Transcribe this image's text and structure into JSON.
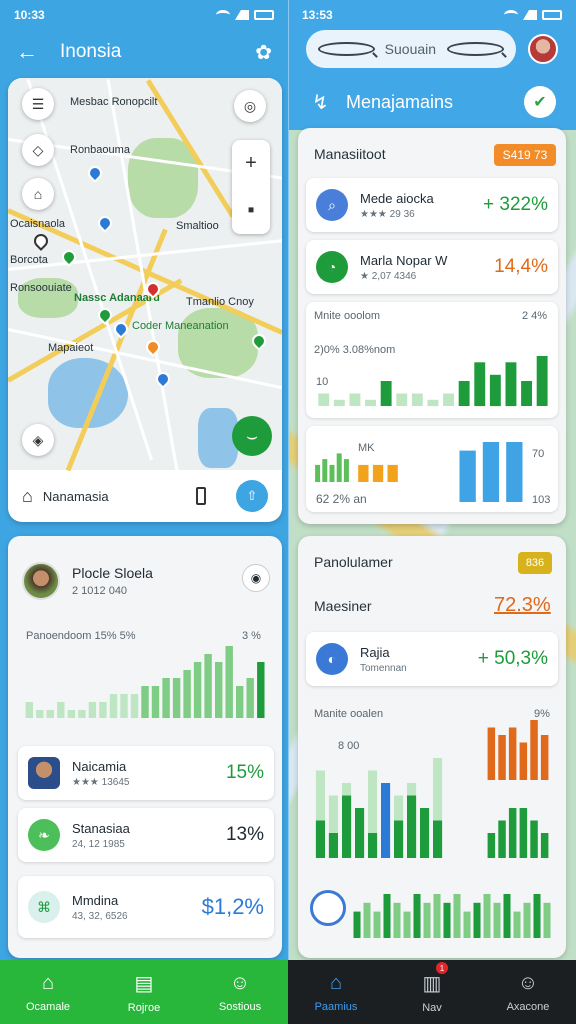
{
  "status": {
    "left_time": "10:33",
    "right_time": "13:53"
  },
  "left_header": {
    "title": "Inonsia"
  },
  "right_header": {
    "search_placeholder": "Suouain",
    "title": "Menajamains"
  },
  "map": {
    "labels": [
      "Mesbac Ronopcilt",
      "Ronbaouma",
      "Smaltioo",
      "Ocaisnaola",
      "Borcota",
      "Ronsoouiate",
      "Tmanlio Cnoy",
      "Nassc Adanaaru",
      "Coder Maneanation",
      "Mapaieot"
    ],
    "location_text": "Nanamasia"
  },
  "right_top": {
    "header": "Manasiitoot",
    "badge": "S419 73",
    "rows": [
      {
        "name": "Mede aiocka",
        "sub": "★★★ 29 36",
        "value": "+ 322%",
        "value_color": "#1e9c3b",
        "icon_color": "#4a7fd9",
        "icon": "search-icon"
      },
      {
        "name": "Marla Nopar W",
        "sub": "★ 2,07 4346",
        "value": "14,4%",
        "value_color": "#e0691b",
        "icon_color": "#1e9c3b",
        "icon": "chart-icon"
      }
    ],
    "chart1": {
      "label": "Mnite ooolom",
      "right_label": "2 4%",
      "sub_label": "2)0% 3.08%nom",
      "axis_label": "10",
      "values": [
        2,
        1,
        2,
        1,
        4,
        2,
        2,
        1,
        2,
        4,
        7,
        5,
        7,
        4,
        8
      ]
    },
    "chart2": {
      "label": "MK",
      "right_label": "70",
      "bottom_left": "62 2% an",
      "bottom_right": "103",
      "green_values": [
        3,
        4,
        3,
        5,
        4
      ],
      "orange_values": [
        3,
        3,
        3
      ],
      "blue_values": [
        6,
        7,
        7
      ]
    }
  },
  "left_bottom": {
    "profile_name": "Plocle Sloela",
    "profile_sub": "2 1012 040",
    "chart_label": "Panoendoom 15% 5%",
    "chart_right": "3 %",
    "chart_values": [
      2,
      1,
      1,
      2,
      1,
      1,
      2,
      2,
      3,
      3,
      3,
      4,
      4,
      5,
      5,
      6,
      7,
      8,
      7,
      9,
      4,
      5,
      7
    ],
    "rows": [
      {
        "name": "Naicamia",
        "sub": "★★★ 13645",
        "value": "15%",
        "value_color": "#1e9c3b",
        "icon": "person-avatar"
      },
      {
        "name": "Stanasiaa",
        "sub": "24, 12 1985",
        "value": "13%",
        "value_color": "#1f2a33",
        "icon": "leaf-icon"
      },
      {
        "name": "Mmdina",
        "sub": "43, 32, 6526",
        "value": "$1,2%",
        "value_color": "#2b7bd6",
        "icon": "map-icon"
      }
    ]
  },
  "right_bottom": {
    "header": "Panolulamer",
    "badge": "836",
    "sub_header": "Maesiner",
    "big_value": "72.3%",
    "row": {
      "name": "Rajia",
      "sub": "Tomennan",
      "value": "+ 50,3%",
      "value_color": "#1e9c3b"
    },
    "chart1": {
      "label": "Manite ooalen",
      "right_label": "9%",
      "mid_label": "8 00",
      "series_a": [
        7,
        5,
        6,
        4,
        7,
        3,
        5,
        6,
        2,
        8
      ],
      "series_b": [
        3,
        2,
        5,
        4,
        2,
        6,
        3,
        5,
        4,
        3
      ],
      "series_c": [
        7,
        6,
        7,
        5,
        8,
        6
      ],
      "series_d": [
        2,
        3,
        4,
        4,
        3,
        2
      ]
    },
    "chart2_values": [
      3,
      4,
      3,
      5,
      4,
      3,
      5,
      4,
      5,
      4,
      5,
      3,
      4,
      5,
      4,
      5,
      3,
      4,
      5,
      4
    ]
  },
  "nav_left": [
    {
      "label": "Ocamale",
      "icon": "home-icon"
    },
    {
      "label": "Rojroe",
      "icon": "list-icon"
    },
    {
      "label": "Sostious",
      "icon": "person-icon"
    }
  ],
  "nav_right": [
    {
      "label": "Paamius",
      "icon": "home-icon"
    },
    {
      "label": "Nav",
      "icon": "document-icon",
      "badge": "1"
    },
    {
      "label": "Axacone",
      "icon": "person-icon"
    }
  ]
}
